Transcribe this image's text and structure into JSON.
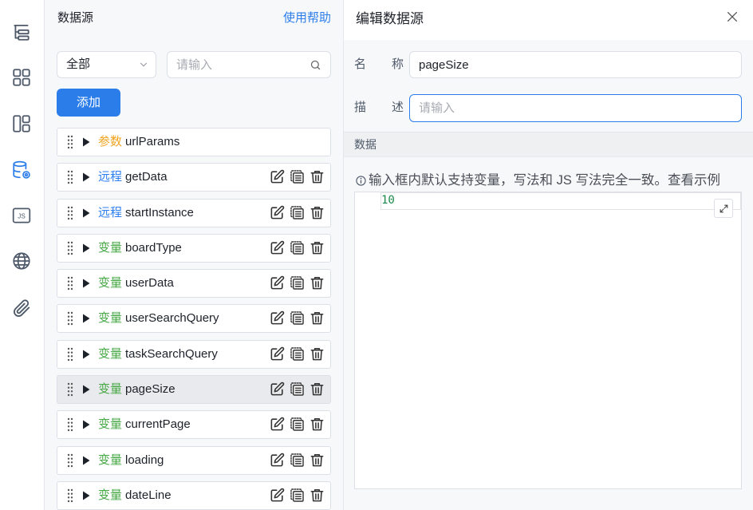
{
  "sidebar": {
    "icons": [
      "outline-icon",
      "components-icon",
      "layout-icon",
      "datasource-icon",
      "js-icon",
      "globe-icon",
      "attachment-icon"
    ],
    "active_index": 3,
    "js_icon_label": "JS"
  },
  "datasource_panel": {
    "title": "数据源",
    "help_link": "使用帮助",
    "filter_selected": "全部",
    "search_placeholder": "请输入",
    "add_button": "添加",
    "selected_index": 7,
    "items": [
      {
        "type": "参数",
        "name": "urlParams",
        "color": "#f0a422",
        "has_actions": false
      },
      {
        "type": "远程",
        "name": "getData",
        "color": "#2d7ff0",
        "has_actions": true
      },
      {
        "type": "远程",
        "name": "startInstance",
        "color": "#2d7ff0",
        "has_actions": true
      },
      {
        "type": "变量",
        "name": "boardType",
        "color": "#45a845",
        "has_actions": true
      },
      {
        "type": "变量",
        "name": "userData",
        "color": "#45a845",
        "has_actions": true
      },
      {
        "type": "变量",
        "name": "userSearchQuery",
        "color": "#45a845",
        "has_actions": true
      },
      {
        "type": "变量",
        "name": "taskSearchQuery",
        "color": "#45a845",
        "has_actions": true
      },
      {
        "type": "变量",
        "name": "pageSize",
        "color": "#45a845",
        "has_actions": true
      },
      {
        "type": "变量",
        "name": "currentPage",
        "color": "#45a845",
        "has_actions": true
      },
      {
        "type": "变量",
        "name": "loading",
        "color": "#45a845",
        "has_actions": true
      },
      {
        "type": "变量",
        "name": "dateLine",
        "color": "#45a845",
        "has_actions": true
      }
    ]
  },
  "editor_panel": {
    "title": "编辑数据源",
    "name_label": "名称",
    "name_value": "pageSize",
    "desc_label": "描述",
    "desc_placeholder": "请输入",
    "section_title": "数据",
    "hint_text": "输入框内默认支持变量，写法和 JS 写法完全一致。",
    "hint_link": "查看示例",
    "code_lines": [
      "10"
    ]
  },
  "colors": {
    "accent": "#2b7de9",
    "code_text": "#1c8a4a",
    "selected_row": "#e9eaed"
  }
}
